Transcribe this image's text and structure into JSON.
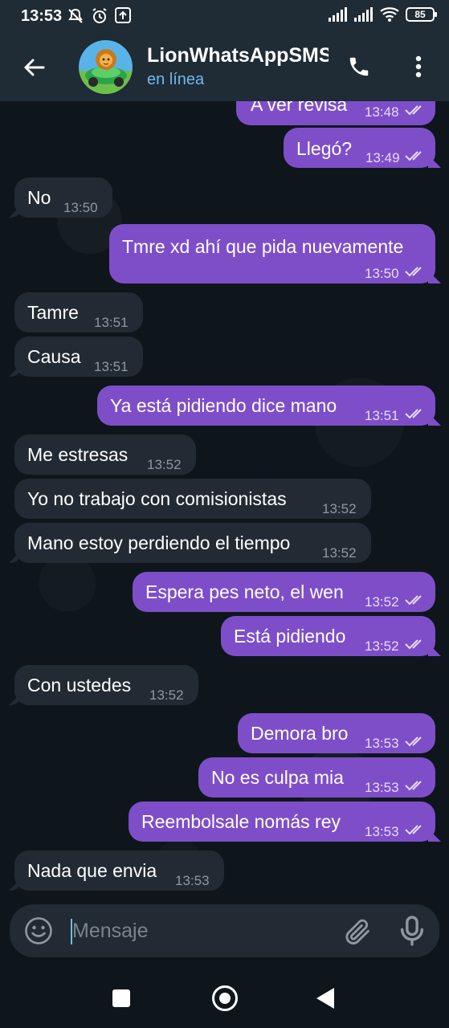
{
  "status_bar": {
    "time": "13:53",
    "battery": "85",
    "icons": [
      "mute-icon",
      "alarm-icon",
      "upload-icon",
      "signal-icon",
      "signal-icon",
      "wifi-icon",
      "battery-icon"
    ]
  },
  "header": {
    "contact_name": "LionWhatsAppSMS",
    "status": "en línea",
    "icons": [
      "back-arrow-icon",
      "phone-icon",
      "more-vertical-icon"
    ]
  },
  "messages": [
    {
      "dir": "out",
      "text": "A ver revisa",
      "time": "13:48",
      "read": true
    },
    {
      "dir": "out",
      "text": "Llegó?",
      "time": "13:49",
      "read": true
    },
    {
      "dir": "in",
      "text": "No",
      "time": "13:50"
    },
    {
      "dir": "out",
      "text": "Tmre xd ahí que pida nuevamente",
      "time": "13:50",
      "read": true
    },
    {
      "dir": "in",
      "text": "Tamre",
      "time": "13:51"
    },
    {
      "dir": "in",
      "text": "Causa",
      "time": "13:51"
    },
    {
      "dir": "out",
      "text": "Ya está pidiendo dice mano",
      "time": "13:51",
      "read": true
    },
    {
      "dir": "in",
      "text": "Me estresas",
      "time": "13:52"
    },
    {
      "dir": "in",
      "text": "Yo no trabajo con comisionistas",
      "time": "13:52"
    },
    {
      "dir": "in",
      "text": "Mano estoy perdiendo el tiempo",
      "time": "13:52"
    },
    {
      "dir": "out",
      "text": "Espera pes neto, el wen",
      "time": "13:52",
      "read": true
    },
    {
      "dir": "out",
      "text": "Está pidiendo",
      "time": "13:52",
      "read": true
    },
    {
      "dir": "in",
      "text": "Con ustedes",
      "time": "13:52"
    },
    {
      "dir": "out",
      "text": "Demora bro",
      "time": "13:53",
      "read": true
    },
    {
      "dir": "out",
      "text": "No es culpa mia",
      "time": "13:53",
      "read": true
    },
    {
      "dir": "out",
      "text": "Reembolsale nomás rey",
      "time": "13:53",
      "read": true
    },
    {
      "dir": "in",
      "text": "Nada que envia",
      "time": "13:53"
    }
  ],
  "composer": {
    "placeholder": "Mensaje",
    "icons": [
      "emoji-icon",
      "attach-icon",
      "microphone-icon"
    ]
  },
  "nav_bar": {
    "icons": [
      "recents-icon",
      "home-icon",
      "back-icon"
    ]
  },
  "colors": {
    "header_bg": "#1f2b35",
    "chat_bg": "#0e161c",
    "incoming_bubble": "#222b33",
    "outgoing_bubble": "#7e4ec9",
    "accent": "#6fb9f0"
  }
}
